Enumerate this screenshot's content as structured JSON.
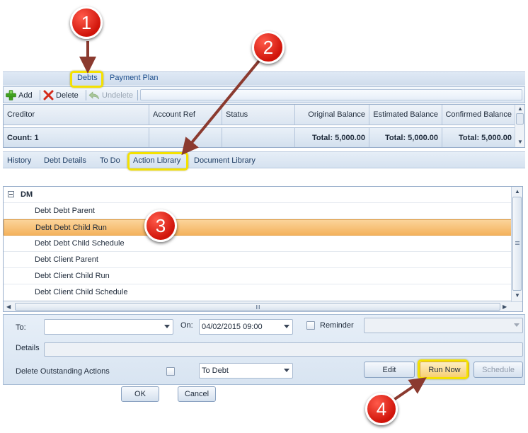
{
  "top_tabs": [
    "Debts",
    "Payment Plan"
  ],
  "toolbar": {
    "add_label": "Add",
    "delete_label": "Delete",
    "undelete_label": "Undelete"
  },
  "debts_grid": {
    "columns": [
      "Creditor",
      "Account Ref",
      "Status",
      "Original Balance",
      "Estimated Balance",
      "Confirmed Balance"
    ],
    "footer": {
      "count": "Count: 1",
      "total_original": "Total: 5,000.00",
      "total_estimated": "Total: 5,000.00",
      "total_confirmed": "Total: 5,000.00"
    }
  },
  "sub_tabs": [
    "History",
    "Debt Details",
    "To Do",
    "Action Library",
    "Document Library"
  ],
  "action_list": {
    "group": "DM",
    "items": [
      "Debt Debt Parent",
      "Debt Debt Child Run",
      "Debt Debt Child Schedule",
      "Debt Client Parent",
      "Debt Client Child Run",
      "Debt Client Child Schedule"
    ],
    "selected_index": 1
  },
  "form": {
    "to_label": "To:",
    "to_value": "",
    "on_label": "On:",
    "on_value": "04/02/2015 09:00",
    "reminder_label": "Reminder",
    "reminder_value": "",
    "details_label": "Details",
    "details_value": "",
    "delete_outstanding_label": "Delete Outstanding Actions",
    "target_value": "To Debt",
    "edit_label": "Edit",
    "run_now_label": "Run Now",
    "schedule_label": "Schedule"
  },
  "dialog_buttons": {
    "ok_label": "OK",
    "cancel_label": "Cancel"
  },
  "callouts": [
    "1",
    "2",
    "3",
    "4"
  ],
  "colors": {
    "callout_red": "#d0140a",
    "highlight_yellow": "#f4e100",
    "selected_row": "#f4b25d",
    "pointer_brown": "#8b3a2f"
  }
}
